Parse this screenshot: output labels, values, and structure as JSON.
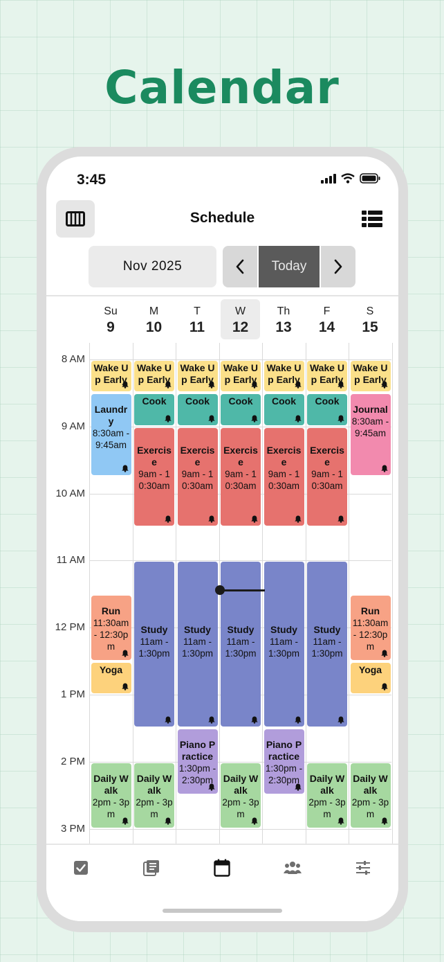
{
  "hero": {
    "title": "Calendar"
  },
  "status_bar": {
    "time": "3:45"
  },
  "header": {
    "title": "Schedule"
  },
  "nav": {
    "month": "Nov 2025",
    "today_label": "Today"
  },
  "days": [
    {
      "dow": "Su",
      "num": "9"
    },
    {
      "dow": "M",
      "num": "10"
    },
    {
      "dow": "T",
      "num": "11"
    },
    {
      "dow": "W",
      "num": "12",
      "selected": true
    },
    {
      "dow": "Th",
      "num": "13"
    },
    {
      "dow": "F",
      "num": "14"
    },
    {
      "dow": "S",
      "num": "15"
    }
  ],
  "time_labels": [
    "8 AM",
    "9 AM",
    "10 AM",
    "11 AM",
    "12 PM",
    "1 PM",
    "2 PM",
    "3 PM"
  ],
  "colors": {
    "wake": "#fbe08a",
    "laundry": "#90c8f4",
    "cook": "#4fb8a8",
    "journal": "#f28aae",
    "exercise": "#e6726e",
    "study": "#7985c9",
    "run": "#f7a285",
    "yoga": "#fdd27c",
    "piano": "#b19ddb",
    "walk": "#a6d8a0",
    "accent": "#1b8a5f"
  },
  "events": [
    {
      "col": 0,
      "title": "Wake Up Early",
      "time": "",
      "start": 8.0,
      "end": 8.5,
      "color": "wake"
    },
    {
      "col": 1,
      "title": "Wake Up Early",
      "time": "",
      "start": 8.0,
      "end": 8.5,
      "color": "wake"
    },
    {
      "col": 2,
      "title": "Wake Up Early",
      "time": "",
      "start": 8.0,
      "end": 8.5,
      "color": "wake"
    },
    {
      "col": 3,
      "title": "Wake Up Early",
      "time": "",
      "start": 8.0,
      "end": 8.5,
      "color": "wake"
    },
    {
      "col": 4,
      "title": "Wake Up Early",
      "time": "",
      "start": 8.0,
      "end": 8.5,
      "color": "wake"
    },
    {
      "col": 5,
      "title": "Wake Up Early",
      "time": "",
      "start": 8.0,
      "end": 8.5,
      "color": "wake"
    },
    {
      "col": 6,
      "title": "Wake Up Early",
      "time": "",
      "start": 8.0,
      "end": 8.5,
      "color": "wake"
    },
    {
      "col": 0,
      "title": "Laundry",
      "time": "8:30am - 9:45am",
      "start": 8.5,
      "end": 9.75,
      "color": "laundry"
    },
    {
      "col": 1,
      "title": "Cook",
      "time": "",
      "start": 8.5,
      "end": 9.0,
      "color": "cook"
    },
    {
      "col": 2,
      "title": "Cook",
      "time": "",
      "start": 8.5,
      "end": 9.0,
      "color": "cook"
    },
    {
      "col": 3,
      "title": "Cook",
      "time": "",
      "start": 8.5,
      "end": 9.0,
      "color": "cook"
    },
    {
      "col": 4,
      "title": "Cook",
      "time": "",
      "start": 8.5,
      "end": 9.0,
      "color": "cook"
    },
    {
      "col": 5,
      "title": "Cook",
      "time": "",
      "start": 8.5,
      "end": 9.0,
      "color": "cook"
    },
    {
      "col": 6,
      "title": "Journal",
      "time": "8:30am - 9:45am",
      "start": 8.5,
      "end": 9.75,
      "color": "journal"
    },
    {
      "col": 1,
      "title": "Exercise",
      "time": "9am - 10:30am",
      "start": 9.0,
      "end": 10.5,
      "color": "exercise"
    },
    {
      "col": 2,
      "title": "Exercise",
      "time": "9am - 10:30am",
      "start": 9.0,
      "end": 10.5,
      "color": "exercise"
    },
    {
      "col": 3,
      "title": "Exercise",
      "time": "9am - 10:30am",
      "start": 9.0,
      "end": 10.5,
      "color": "exercise"
    },
    {
      "col": 4,
      "title": "Exercise",
      "time": "9am - 10:30am",
      "start": 9.0,
      "end": 10.5,
      "color": "exercise"
    },
    {
      "col": 5,
      "title": "Exercise",
      "time": "9am - 10:30am",
      "start": 9.0,
      "end": 10.5,
      "color": "exercise"
    },
    {
      "col": 1,
      "title": "Study",
      "time": "11am - 1:30pm",
      "start": 11.0,
      "end": 13.5,
      "color": "study"
    },
    {
      "col": 2,
      "title": "Study",
      "time": "11am - 1:30pm",
      "start": 11.0,
      "end": 13.5,
      "color": "study"
    },
    {
      "col": 3,
      "title": "Study",
      "time": "11am - 1:30pm",
      "start": 11.0,
      "end": 13.5,
      "color": "study"
    },
    {
      "col": 4,
      "title": "Study",
      "time": "11am - 1:30pm",
      "start": 11.0,
      "end": 13.5,
      "color": "study"
    },
    {
      "col": 5,
      "title": "Study",
      "time": "11am - 1:30pm",
      "start": 11.0,
      "end": 13.5,
      "color": "study"
    },
    {
      "col": 0,
      "title": "Run",
      "time": "11:30am - 12:30pm",
      "start": 11.5,
      "end": 12.5,
      "color": "run"
    },
    {
      "col": 6,
      "title": "Run",
      "time": "11:30am - 12:30pm",
      "start": 11.5,
      "end": 12.5,
      "color": "run"
    },
    {
      "col": 0,
      "title": "Yoga",
      "time": "",
      "start": 12.5,
      "end": 13.0,
      "color": "yoga"
    },
    {
      "col": 6,
      "title": "Yoga",
      "time": "",
      "start": 12.5,
      "end": 13.0,
      "color": "yoga"
    },
    {
      "col": 2,
      "title": "Piano Practice",
      "time": "1:30pm - 2:30pm",
      "start": 13.5,
      "end": 14.5,
      "color": "piano"
    },
    {
      "col": 4,
      "title": "Piano Practice",
      "time": "1:30pm - 2:30pm",
      "start": 13.5,
      "end": 14.5,
      "color": "piano"
    },
    {
      "col": 0,
      "title": "Daily Walk",
      "time": "2pm - 3pm",
      "start": 14.0,
      "end": 15.0,
      "color": "walk"
    },
    {
      "col": 1,
      "title": "Daily Walk",
      "time": "2pm - 3pm",
      "start": 14.0,
      "end": 15.0,
      "color": "walk"
    },
    {
      "col": 3,
      "title": "Daily Walk",
      "time": "2pm - 3pm",
      "start": 14.0,
      "end": 15.0,
      "color": "walk"
    },
    {
      "col": 5,
      "title": "Daily Walk",
      "time": "2pm - 3pm",
      "start": 14.0,
      "end": 15.0,
      "color": "walk"
    },
    {
      "col": 6,
      "title": "Daily Walk",
      "time": "2pm - 3pm",
      "start": 14.0,
      "end": 15.0,
      "color": "walk"
    }
  ],
  "tabs": [
    {
      "icon": "checkbox-icon"
    },
    {
      "icon": "journal-icon"
    },
    {
      "icon": "calendar-icon",
      "active": true
    },
    {
      "icon": "group-icon"
    },
    {
      "icon": "settings-sliders-icon"
    }
  ]
}
